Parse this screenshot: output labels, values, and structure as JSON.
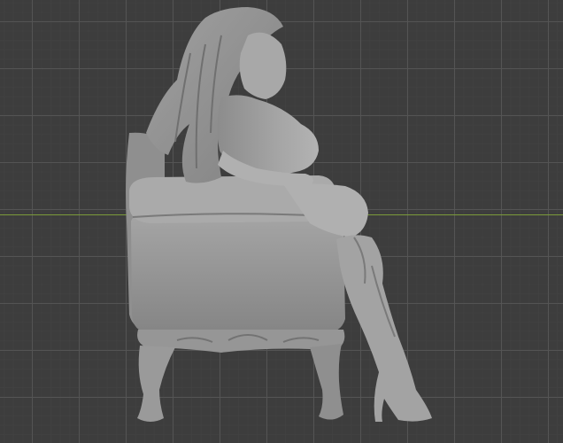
{
  "viewport": {
    "background_color": "#3d3d3d",
    "grid_color": "#5a5a5a",
    "axis_color": "#7a9a3a",
    "model_color": "#9a9a9a",
    "model_shadow_color": "#6e6e6e",
    "model_highlight_color": "#b8b8b8"
  },
  "model": {
    "subject": "seated-figure-in-armchair-sculpt"
  }
}
